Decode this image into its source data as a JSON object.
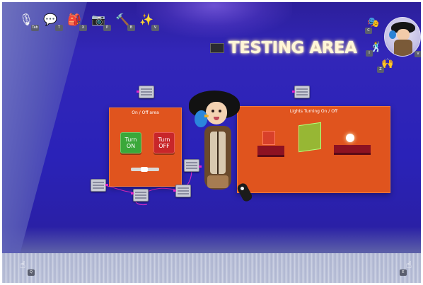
{
  "toolbar": {
    "items": [
      {
        "icon": "microphone-icon",
        "glyph": "🎙",
        "key": "Tab"
      },
      {
        "icon": "speech-bubble-icon",
        "glyph": "💬",
        "key": "T"
      },
      {
        "icon": "backpack-icon",
        "glyph": "🎒",
        "key": "X"
      },
      {
        "icon": "camera-icon",
        "glyph": "📷",
        "key": "P"
      },
      {
        "icon": "hammer-icon",
        "glyph": "🔨",
        "key": "B"
      },
      {
        "icon": "wand-icon",
        "glyph": "✨",
        "key": "V"
      }
    ]
  },
  "title_sign": {
    "text": "TESTING AREA"
  },
  "user_panel": {
    "emote_icon": "mask-icon",
    "emote_glyph": "🎭",
    "emote_key": "C",
    "dance_icon": "figure-icon",
    "dance_glyph": "🕺",
    "dance_key": "I",
    "gesture_icon": "wave-icon",
    "gesture_glyph": "🙌",
    "gesture_key": "Z",
    "profile_key": "V"
  },
  "panel_left": {
    "title": "On / Off area",
    "on_label": "Turn ON",
    "off_label": "Turn OFF"
  },
  "panel_right": {
    "title": "Lights Turning On / Off"
  },
  "hands": {
    "left_key": "Q",
    "right_key": "E",
    "left_icon": "hand-pointer-icon",
    "right_icon": "hand-pointer-icon"
  },
  "colors": {
    "sky": "#3226b8",
    "panel": "#e0541e",
    "on_button": "#3aa83a",
    "off_button": "#c8262a",
    "wire": "#e22ac6",
    "light_cube": "#7fd83c"
  }
}
